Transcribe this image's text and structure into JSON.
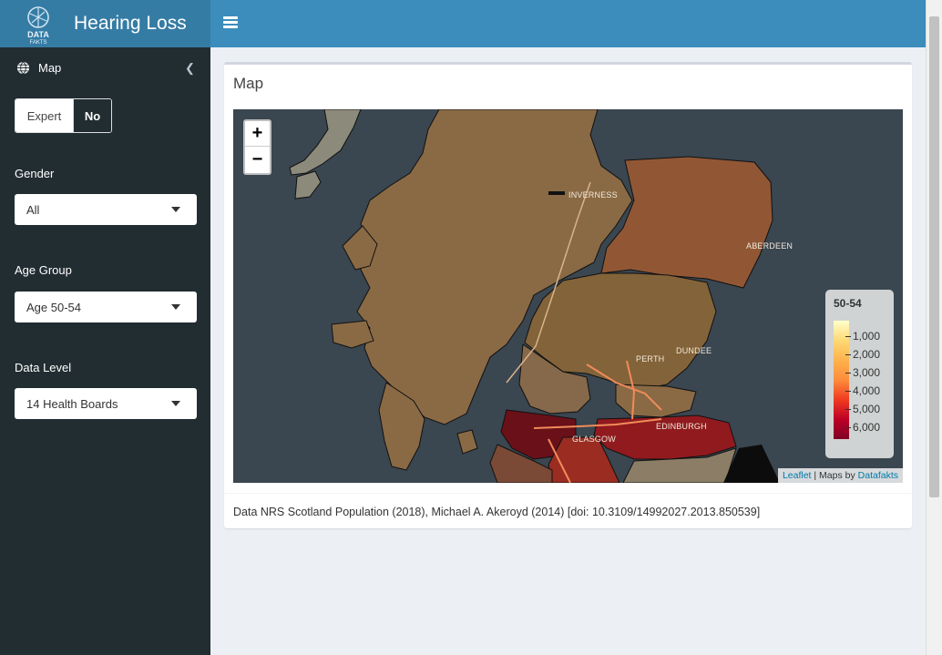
{
  "header": {
    "logo_text": "DATA FAKTS",
    "title": "Hearing Loss"
  },
  "sidebar": {
    "menu_item": "Map",
    "expert_label": "Expert",
    "expert_value": "No",
    "gender": {
      "label": "Gender",
      "value": "All"
    },
    "age_group": {
      "label": "Age Group",
      "value": "Age 50-54"
    },
    "data_level": {
      "label": "Data Level",
      "value": "14 Health Boards"
    }
  },
  "box": {
    "title": "Map",
    "footer": "Data NRS Scotland Population (2018), Michael A. Akeroyd (2014) [doi: 10.3109/14992027.2013.850539]"
  },
  "map": {
    "zoom_in": "+",
    "zoom_out": "−",
    "cities": [
      "INVERNESS",
      "ABERDEEN",
      "PERTH",
      "DUNDEE",
      "GLASGOW",
      "EDINBURGH"
    ],
    "legend": {
      "title": "50-54",
      "ticks": [
        "1,000",
        "2,000",
        "3,000",
        "4,000",
        "5,000",
        "6,000"
      ]
    },
    "attribution": {
      "leaflet": "Leaflet",
      "sep": " | Maps by ",
      "maker": "Datafakts"
    }
  },
  "colors": {
    "header_dark": "#357ca5",
    "header": "#3c8dbc",
    "sidebar": "#222d32",
    "map_sea": "#3a4650"
  }
}
